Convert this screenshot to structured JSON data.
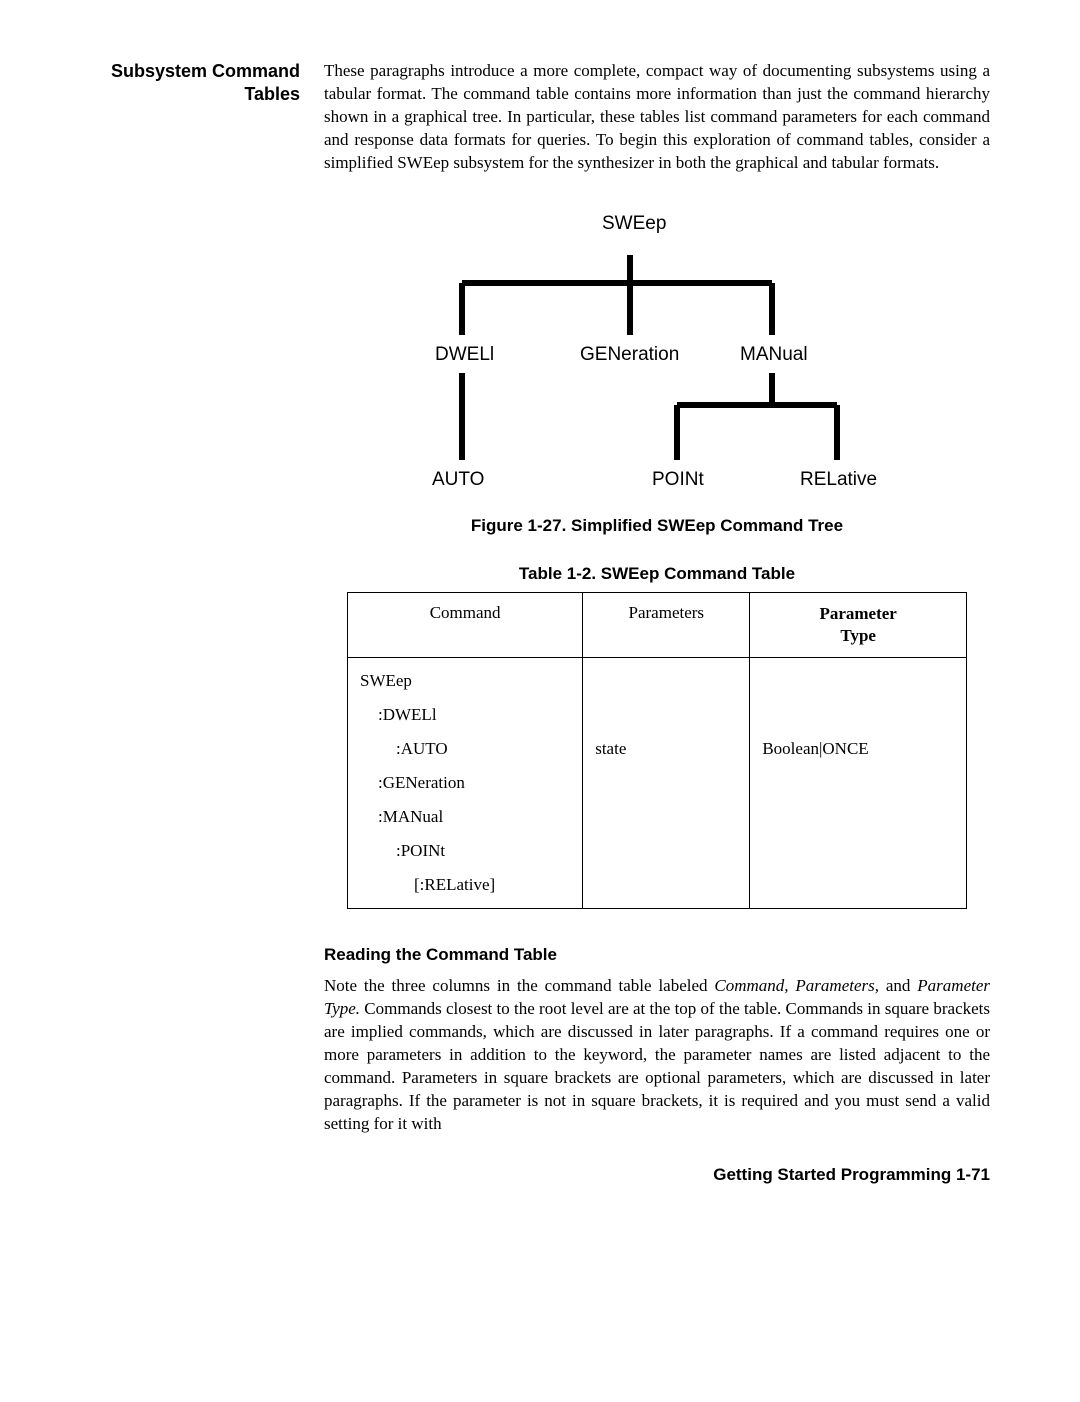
{
  "section": {
    "heading": "Subsystem Command Tables",
    "intro": "These paragraphs introduce a more complete, compact way of documenting subsystems using a tabular format. The command table contains more information than just the command hierarchy shown in a graphical tree. In particular, these tables list command parameters for each command and response data formats for queries. To begin this exploration of command tables, consider a simplified SWEep subsystem for the synthesizer in both the graphical and tabular formats."
  },
  "diagram": {
    "root": "SWEep",
    "nodes": {
      "dwell": "DWELl",
      "generation": "GENeration",
      "manual": "MANual",
      "auto": "AUTO",
      "point": "POINt",
      "relative": "RELative"
    },
    "caption": "Figure 1-27. Simplified SWEep Command Tree"
  },
  "table": {
    "title": "Table 1-2. SWEep Command Table",
    "headers": {
      "command": "Command",
      "parameters": "Parameters",
      "param_type_1": "Parameter",
      "param_type_2": "Type"
    },
    "rows": {
      "sweep": "SWEep",
      "dwell": ":DWELl",
      "auto": ":AUTO",
      "generation": ":GENeration",
      "manual": ":MANual",
      "point": ":POINt",
      "relative": "[:RELative]",
      "param_state": "state",
      "type_state": "Boolean|ONCE"
    }
  },
  "reading": {
    "heading": "Reading the Command Table",
    "para_1": "Note the three columns in the command table labeled ",
    "ital_1": "Command, Parameters,",
    "para_2": " and ",
    "ital_2": "Parameter Type.",
    "para_3": " Commands closest to the root level are at the top of the table. Commands in square brackets are implied commands, which are discussed in later paragraphs. If a command requires one or more parameters in addition to the keyword, the parameter names are listed adjacent to the command. Parameters in square brackets are optional parameters, which are discussed in later paragraphs. If the parameter is not in square brackets, it is required and you must send a valid setting for it with"
  },
  "footer": "Getting Started Programming 1-71"
}
